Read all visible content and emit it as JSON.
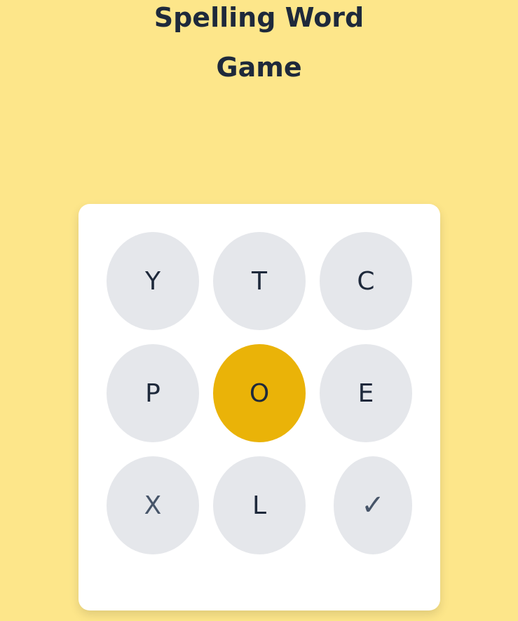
{
  "title": {
    "line1": "Spelling Word",
    "line2": "Game"
  },
  "board": {
    "keys": [
      {
        "label": "Y"
      },
      {
        "label": "T"
      },
      {
        "label": "C"
      },
      {
        "label": "P"
      },
      {
        "label": "O",
        "state": "selected"
      },
      {
        "label": "E"
      },
      {
        "label": "X"
      },
      {
        "label": "L"
      }
    ],
    "submit": {
      "label": "✓",
      "icon": "checkmark-icon"
    }
  },
  "colors": {
    "background": "#fde68a",
    "card": "#ffffff",
    "key": "#e5e7eb",
    "selected_key": "#eab308",
    "text": "#1e293b"
  }
}
